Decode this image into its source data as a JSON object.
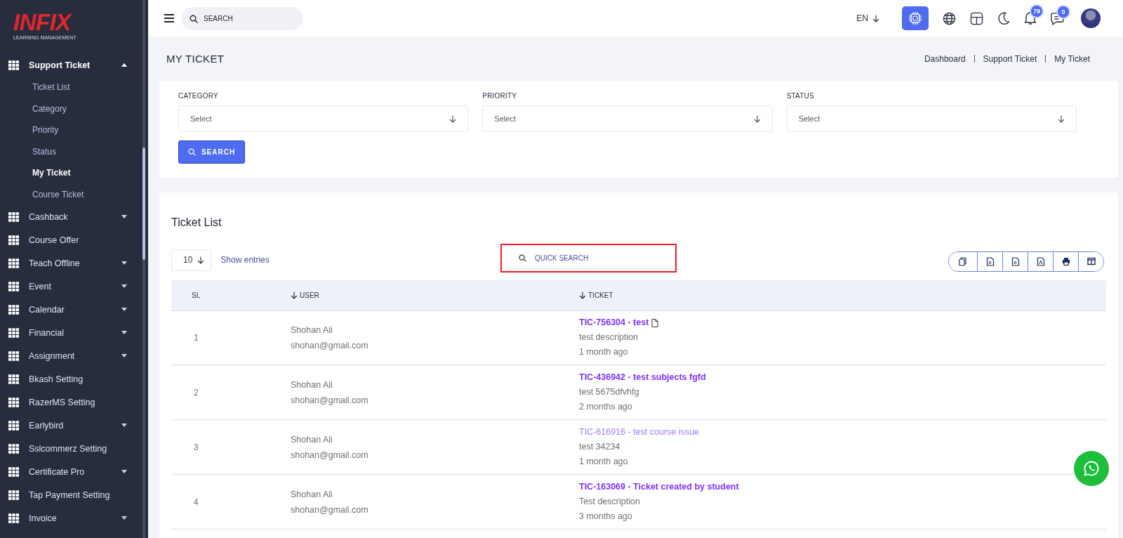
{
  "logo": {
    "title": "INFIX",
    "subtitle": "LEARNING MANAGEMENT"
  },
  "sidebar": {
    "items": [
      {
        "label": "Support Ticket",
        "kind": "dropdown",
        "expanded": true,
        "children": [
          {
            "label": "Ticket List",
            "selected": false
          },
          {
            "label": "Category",
            "selected": false
          },
          {
            "label": "Priority",
            "selected": false
          },
          {
            "label": "Status",
            "selected": false
          },
          {
            "label": "My Ticket",
            "selected": true
          },
          {
            "label": "Course Ticket",
            "selected": false
          }
        ]
      },
      {
        "label": "Cashback",
        "kind": "dropdown",
        "expanded": false
      },
      {
        "label": "Course Offer",
        "kind": "link"
      },
      {
        "label": "Teach Offline",
        "kind": "dropdown",
        "expanded": false
      },
      {
        "label": "Event",
        "kind": "dropdown",
        "expanded": false
      },
      {
        "label": "Calendar",
        "kind": "dropdown",
        "expanded": false
      },
      {
        "label": "Financial",
        "kind": "dropdown",
        "expanded": false
      },
      {
        "label": "Assignment",
        "kind": "dropdown",
        "expanded": false
      },
      {
        "label": "Bkash Setting",
        "kind": "link"
      },
      {
        "label": "RazerMS Setting",
        "kind": "link"
      },
      {
        "label": "Earlybird",
        "kind": "dropdown",
        "expanded": false
      },
      {
        "label": "Sslcommerz Setting",
        "kind": "link"
      },
      {
        "label": "Certificate Pro",
        "kind": "dropdown",
        "expanded": false
      },
      {
        "label": "Tap Payment Setting",
        "kind": "link"
      },
      {
        "label": "Invoice",
        "kind": "dropdown",
        "expanded": false
      }
    ]
  },
  "topbar": {
    "search": {
      "placeholder": "SEARCH"
    },
    "language": "EN",
    "notifications": "79",
    "messages": "0"
  },
  "page": {
    "title": "MY TICKET",
    "breadcrumb": [
      "Dashboard",
      "Support Ticket",
      "My Ticket"
    ]
  },
  "filters": {
    "fields": [
      {
        "label": "CATEGORY",
        "value": "Select"
      },
      {
        "label": "PRIORITY",
        "value": "Select"
      },
      {
        "label": "STATUS",
        "value": "Select"
      }
    ],
    "button": "SEARCH"
  },
  "ticket_list": {
    "title": "Ticket List",
    "page_size": "10",
    "page_size_label": "Show entries",
    "quick_search": {
      "placeholder": "QUICK SEARCH",
      "highlighted": true
    },
    "columns": [
      {
        "label": "SL",
        "sortable": false
      },
      {
        "label": "USER",
        "sortable": true
      },
      {
        "label": "TICKET",
        "sortable": true
      }
    ],
    "rows": [
      {
        "sl": "1",
        "name": "Shohan Ali",
        "email": "shohan@gmail.com",
        "ticket": "TIC-756304 - test",
        "attachment": true,
        "read": false,
        "description": "test description",
        "time": "1 month ago"
      },
      {
        "sl": "2",
        "name": "Shohan Ali",
        "email": "shohan@gmail.com",
        "ticket": "TIC-436942 - test subjects fgfd",
        "attachment": false,
        "read": false,
        "description": "test 5675dfvhfg",
        "time": "2 months ago"
      },
      {
        "sl": "3",
        "name": "Shohan Ali",
        "email": "shohan@gmail.com",
        "ticket": "TIC-616916 - test course issue",
        "attachment": false,
        "read": true,
        "description": "test 34234",
        "time": "1 month ago"
      },
      {
        "sl": "4",
        "name": "Shohan Ali",
        "email": "shohan@gmail.com",
        "ticket": "TIC-163069 - Ticket created by student",
        "attachment": false,
        "read": false,
        "description": "Test description",
        "time": "3 months ago"
      }
    ]
  }
}
